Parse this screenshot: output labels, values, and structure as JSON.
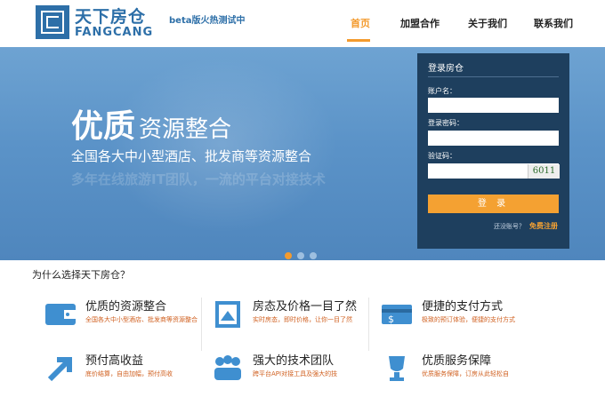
{
  "header": {
    "brand_cn": "天下房仓",
    "brand_en": "FANGCANG",
    "beta": "beta版火热测试中",
    "nav": [
      "首页",
      "加盟合作",
      "关于我们",
      "联系我们"
    ]
  },
  "banner": {
    "title_big": "优质",
    "title_rest": "资源整合",
    "subtitle": "全国各大中小型酒店、批发商等资源整合",
    "shadow_text": "多年在线旅游IT团队，一流的平台对接技术"
  },
  "login": {
    "title": "登录房仓",
    "username_label": "账户名：",
    "password_label": "登录密码：",
    "captcha_label": "验证码：",
    "captcha_value": "6011",
    "login_button": "登 录",
    "no_account": "还没账号？",
    "register_link": "免费注册"
  },
  "section_title": "为什么选择天下房仓？",
  "features": [
    {
      "title": "优质的资源整合",
      "desc": "全国各大中小型酒店、批发商等资源整合"
    },
    {
      "title": "房态及价格一目了然",
      "desc": "实时房态，即时价格，让你一目了然"
    },
    {
      "title": "便捷的支付方式",
      "desc": "极致的预订体验，便捷的支付方式"
    },
    {
      "title": "预付高收益",
      "desc": "底价结算，自由加幅，预付高收"
    },
    {
      "title": "强大的技术团队",
      "desc": "跨平台API对接工具及强大的技"
    },
    {
      "title": "优质服务保障",
      "desc": "优质服务保障，订房从此轻松自"
    }
  ],
  "colors": {
    "brand_blue": "#2d6fa8",
    "accent_orange": "#f39b2e",
    "login_panel": "#1e3f5e"
  }
}
